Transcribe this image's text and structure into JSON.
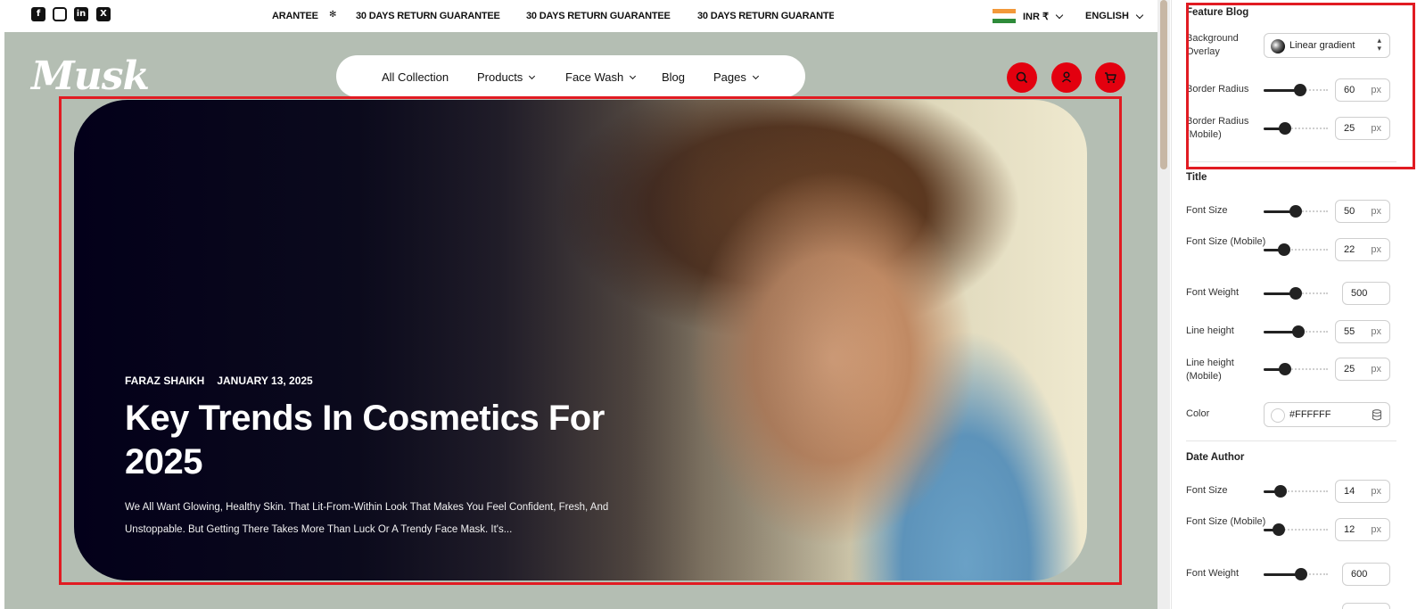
{
  "announcement": {
    "social_icons": [
      "facebook-icon",
      "instagram-icon",
      "linkedin-icon",
      "x-icon"
    ],
    "marquee": [
      "ARANTEE",
      "30 DAYS RETURN GUARANTEE",
      "30 DAYS RETURN GUARANTEE",
      "30 DAYS RETURN GUARANTE"
    ],
    "currency": "INR ₹",
    "language": "ENGLISH"
  },
  "header": {
    "logo": "Musk",
    "nav": [
      {
        "label": "All Collection",
        "has_dropdown": false
      },
      {
        "label": "Products",
        "has_dropdown": true
      },
      {
        "label": "Face Wash",
        "has_dropdown": true
      },
      {
        "label": "Blog",
        "has_dropdown": false
      },
      {
        "label": "Pages",
        "has_dropdown": true
      }
    ],
    "action_icons": [
      "search-icon",
      "user-icon",
      "cart-icon"
    ],
    "accent_color": "#e3000f"
  },
  "hero": {
    "author": "FARAZ SHAIKH",
    "date": "JANUARY 13, 2025",
    "title": "Key Trends In Cosmetics For 2025",
    "excerpt": "We All Want Glowing, Healthy Skin. That Lit-From-Within Look That Makes You Feel Confident, Fresh, And Unstoppable. But Getting There Takes More Than Luck Or A Trendy Face Mask. It's..."
  },
  "panel": {
    "feature_blog": {
      "title": "Feature Blog",
      "background_overlay_label": "Background Overlay",
      "background_overlay_value": "Linear gradient",
      "border_radius_label": "Border Radius",
      "border_radius_value": "60",
      "border_radius_mobile_label": "Border Radius (Mobile)",
      "border_radius_mobile_value": "25",
      "unit": "px"
    },
    "title_section": {
      "title": "Title",
      "font_size_label": "Font Size",
      "font_size_value": "50",
      "font_size_mobile_label": "Font Size (Mobile)",
      "font_size_mobile_value": "22",
      "font_weight_label": "Font Weight",
      "font_weight_value": "500",
      "line_height_label": "Line height",
      "line_height_value": "55",
      "line_height_mobile_label": "Line height (Mobile)",
      "line_height_mobile_value": "25",
      "color_label": "Color",
      "color_value": "#FFFFFF",
      "unit": "px"
    },
    "date_author": {
      "title": "Date Author",
      "font_size_label": "Font Size",
      "font_size_value": "14",
      "font_size_mobile_label": "Font Size (Mobile)",
      "font_size_mobile_value": "12",
      "font_weight_label": "Font Weight",
      "font_weight_value": "600",
      "unit": "px"
    },
    "slider_levels": {
      "border_radius": 0.58,
      "border_radius_mobile": 0.3,
      "title_font_size": 0.5,
      "title_font_size_mobile": 0.27,
      "title_font_weight": 0.5,
      "title_line_height": 0.55,
      "title_line_height_mobile": 0.3,
      "date_font_size": 0.2,
      "date_font_size_mobile": 0.18,
      "date_font_weight": 0.6
    }
  }
}
